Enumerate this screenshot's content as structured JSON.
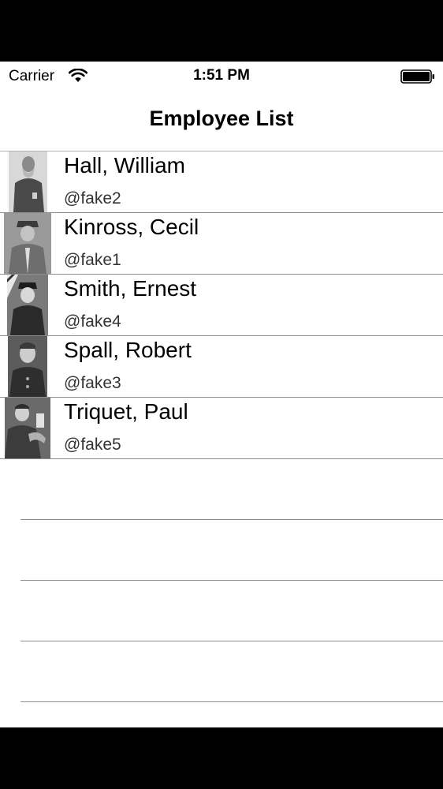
{
  "status_bar": {
    "carrier": "Carrier",
    "time": "1:51 PM",
    "wifi_icon": "wifi-icon",
    "battery_icon": "battery-full-icon"
  },
  "nav": {
    "title": "Employee List"
  },
  "employees": [
    {
      "name": "Hall, William",
      "handle": "@fake2"
    },
    {
      "name": "Kinross, Cecil",
      "handle": "@fake1"
    },
    {
      "name": "Smith, Ernest",
      "handle": "@fake4"
    },
    {
      "name": "Spall, Robert",
      "handle": "@fake3"
    },
    {
      "name": "Triquet, Paul",
      "handle": "@fake5"
    }
  ],
  "colors": {
    "background": "#ffffff",
    "separator": "#8e8e8e",
    "text": "#000000",
    "letterbox": "#000000"
  }
}
